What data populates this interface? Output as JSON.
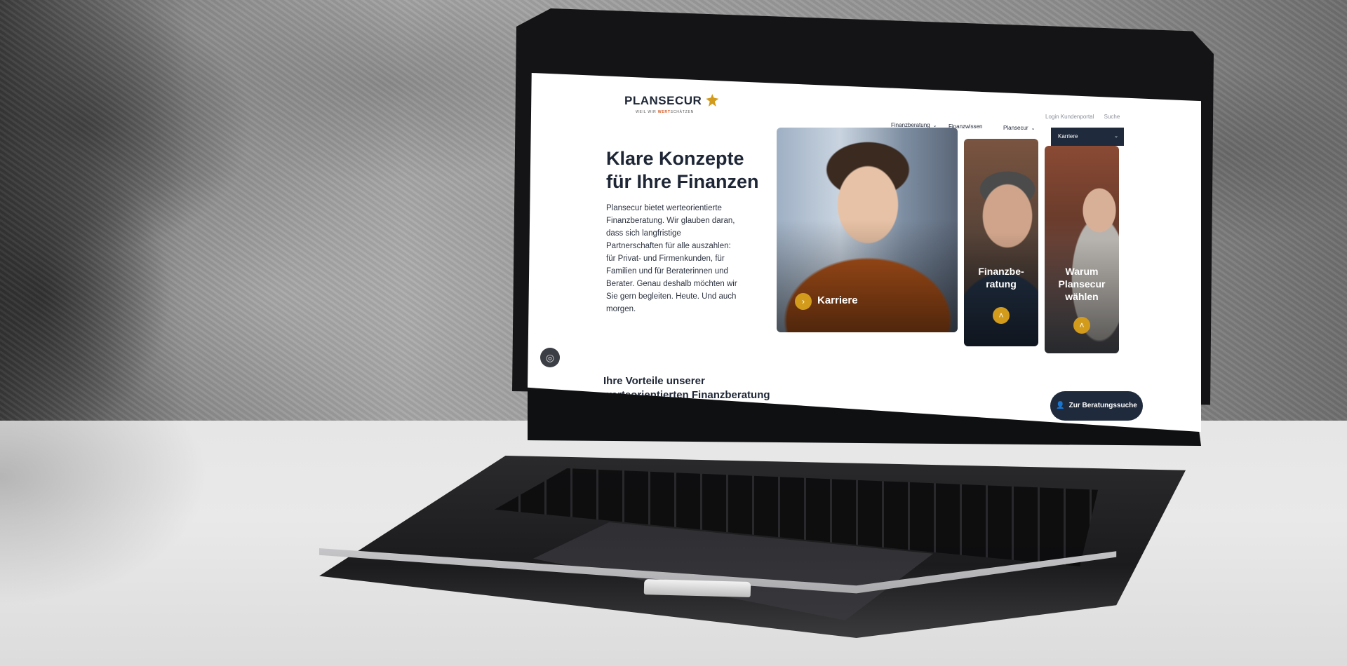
{
  "brand": {
    "name": "PLANSECUR",
    "tagline_pre": "WEIL WIR ",
    "tagline_accent": "WERT",
    "tagline_post": "SCHÄTZEN"
  },
  "utility_nav": [
    "Login Kundenportal",
    "Suche"
  ],
  "main_nav": {
    "items": [
      "Finanzberatung",
      "Finanzwissen",
      "Plansecur"
    ],
    "dropdown_value": "Karriere"
  },
  "hero": {
    "title_line1": "Klare Konzepte",
    "title_line2": "für Ihre Finanzen",
    "text": "Plansecur bietet werteorientierte Finanzberatung. Wir glauben daran, dass sich langfristige Partnerschaften für alle auszahlen: für Privat- und Firmenkunden, für Familien und für Beraterinnen und Berater. Genau deshalb möchten wir Sie gern begleiten. Heute. Und auch morgen."
  },
  "cards": [
    {
      "label": "Karriere",
      "icon": "chevron-right-icon"
    },
    {
      "label": "Finanzbe-ratung",
      "icon": "chevron-up-icon"
    },
    {
      "label": "Warum Plansecur wählen",
      "icon": "chevron-up-icon"
    }
  ],
  "benefits_heading": "Ihre Vorteile unserer werteorientierten Finanzberatung",
  "cta_label": "Zur Beratungssuche",
  "colors": {
    "navy": "#1f2a3c",
    "gold": "#d39b1c",
    "accent_orange": "#d1561f"
  }
}
